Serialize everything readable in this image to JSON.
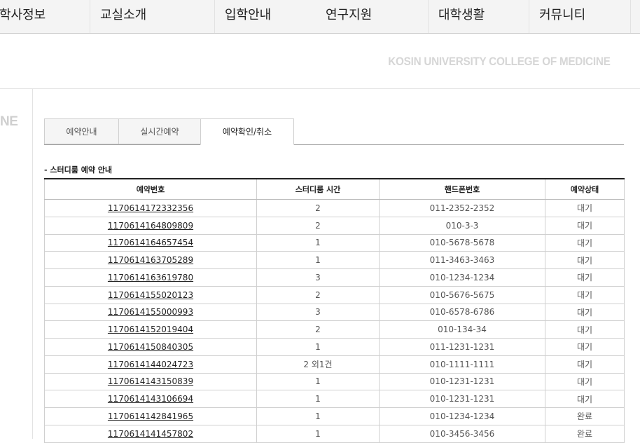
{
  "nav": {
    "items": [
      "학사정보",
      "교실소개",
      "입학안내",
      "연구지원",
      "대학생활",
      "커뮤니티"
    ]
  },
  "banner": {
    "subtitle": "KOSIN UNIVERSITY COLLEGE OF MEDICINE",
    "left_fragment": "NE"
  },
  "tabs": [
    {
      "label": "예약안내"
    },
    {
      "label": "실시간예약"
    },
    {
      "label": "예약확인/취소"
    }
  ],
  "section": {
    "title": "- 스터디룸 예약 안내"
  },
  "table": {
    "headers": [
      "예약번호",
      "스터디룸 시간",
      "핸드폰번호",
      "예약상태"
    ],
    "rows": [
      {
        "id": "1170614172332356",
        "hours": "2",
        "phone": "011-2352-2352",
        "status": "대기"
      },
      {
        "id": "1170614164809809",
        "hours": "2",
        "phone": "010-3-3",
        "status": "대기"
      },
      {
        "id": "1170614164657454",
        "hours": "1",
        "phone": "010-5678-5678",
        "status": "대기"
      },
      {
        "id": "1170614163705289",
        "hours": "1",
        "phone": "011-3463-3463",
        "status": "대기"
      },
      {
        "id": "1170614163619780",
        "hours": "3",
        "phone": "010-1234-1234",
        "status": "대기"
      },
      {
        "id": "1170614155020123",
        "hours": "2",
        "phone": "010-5676-5675",
        "status": "대기"
      },
      {
        "id": "1170614155000993",
        "hours": "3",
        "phone": "010-6578-6786",
        "status": "대기"
      },
      {
        "id": "1170614152019404",
        "hours": "2",
        "phone": "010-134-34",
        "status": "대기"
      },
      {
        "id": "1170614150840305",
        "hours": "1",
        "phone": "011-1231-1231",
        "status": "대기"
      },
      {
        "id": "1170614144024723",
        "hours": "2 외1건",
        "phone": "010-1111-1111",
        "status": "대기"
      },
      {
        "id": "1170614143150839",
        "hours": "1",
        "phone": "010-1231-1231",
        "status": "대기"
      },
      {
        "id": "1170614143106694",
        "hours": "1",
        "phone": "010-1231-1231",
        "status": "대기"
      },
      {
        "id": "1170614142841965",
        "hours": "1",
        "phone": "010-1234-1234",
        "status": "완료"
      },
      {
        "id": "1170614141457802",
        "hours": "1",
        "phone": "010-3456-3456",
        "status": "완료"
      }
    ]
  }
}
